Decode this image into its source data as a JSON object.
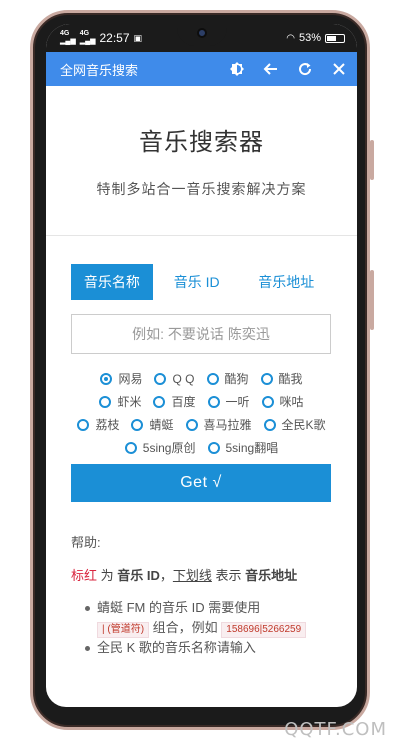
{
  "status_bar": {
    "signal_1": "4G",
    "signal_2": "4G",
    "time": "22:57",
    "battery": "53%"
  },
  "app_bar": {
    "title": "全网音乐搜索",
    "icons": [
      "theme-icon",
      "back-icon",
      "refresh-icon",
      "close-icon"
    ]
  },
  "header": {
    "title": "音乐搜索器",
    "subtitle": "特制多站合一音乐搜索解决方案"
  },
  "tabs": [
    {
      "label": "音乐名称",
      "active": true
    },
    {
      "label": "音乐 ID",
      "active": false
    },
    {
      "label": "音乐地址",
      "active": false
    }
  ],
  "search": {
    "placeholder": "例如: 不要说话 陈奕迅"
  },
  "sources": {
    "row1": [
      {
        "label": "网易",
        "checked": true
      },
      {
        "label": "Q Q",
        "checked": false
      },
      {
        "label": "酷狗",
        "checked": false
      },
      {
        "label": "酷我",
        "checked": false
      }
    ],
    "row2": [
      {
        "label": "虾米",
        "checked": false
      },
      {
        "label": "百度",
        "checked": false
      },
      {
        "label": "一听",
        "checked": false
      },
      {
        "label": "咪咕",
        "checked": false
      }
    ],
    "row3": [
      {
        "label": "荔枝",
        "checked": false
      },
      {
        "label": "蜻蜓",
        "checked": false
      },
      {
        "label": "喜马拉雅",
        "checked": false
      },
      {
        "label": "全民K歌",
        "checked": false
      }
    ],
    "row4": [
      {
        "label": "5sing原创",
        "checked": false
      },
      {
        "label": "5sing翻唱",
        "checked": false
      }
    ]
  },
  "get_button": "Get √",
  "help": {
    "label": "帮助:",
    "legend": {
      "red": "标红",
      "t1": " 为 ",
      "b1": "音乐 ID",
      "t2": "，",
      "u1": "下划线",
      "t3": " 表示 ",
      "b2": "音乐地址"
    },
    "bullet1": {
      "text": "蜻蜓 FM 的音乐 ID 需要使用",
      "code1": "| (管道符)",
      "mid": " 组合，例如 ",
      "code2": "158696|5266259"
    },
    "bullet2": "全民 K 歌的音乐名称请输入"
  },
  "watermark": "QQTF.COM",
  "colors": {
    "app_bar": "#3f8bea",
    "accent": "#1b8fd6",
    "highlight_red": "#d9253f"
  }
}
